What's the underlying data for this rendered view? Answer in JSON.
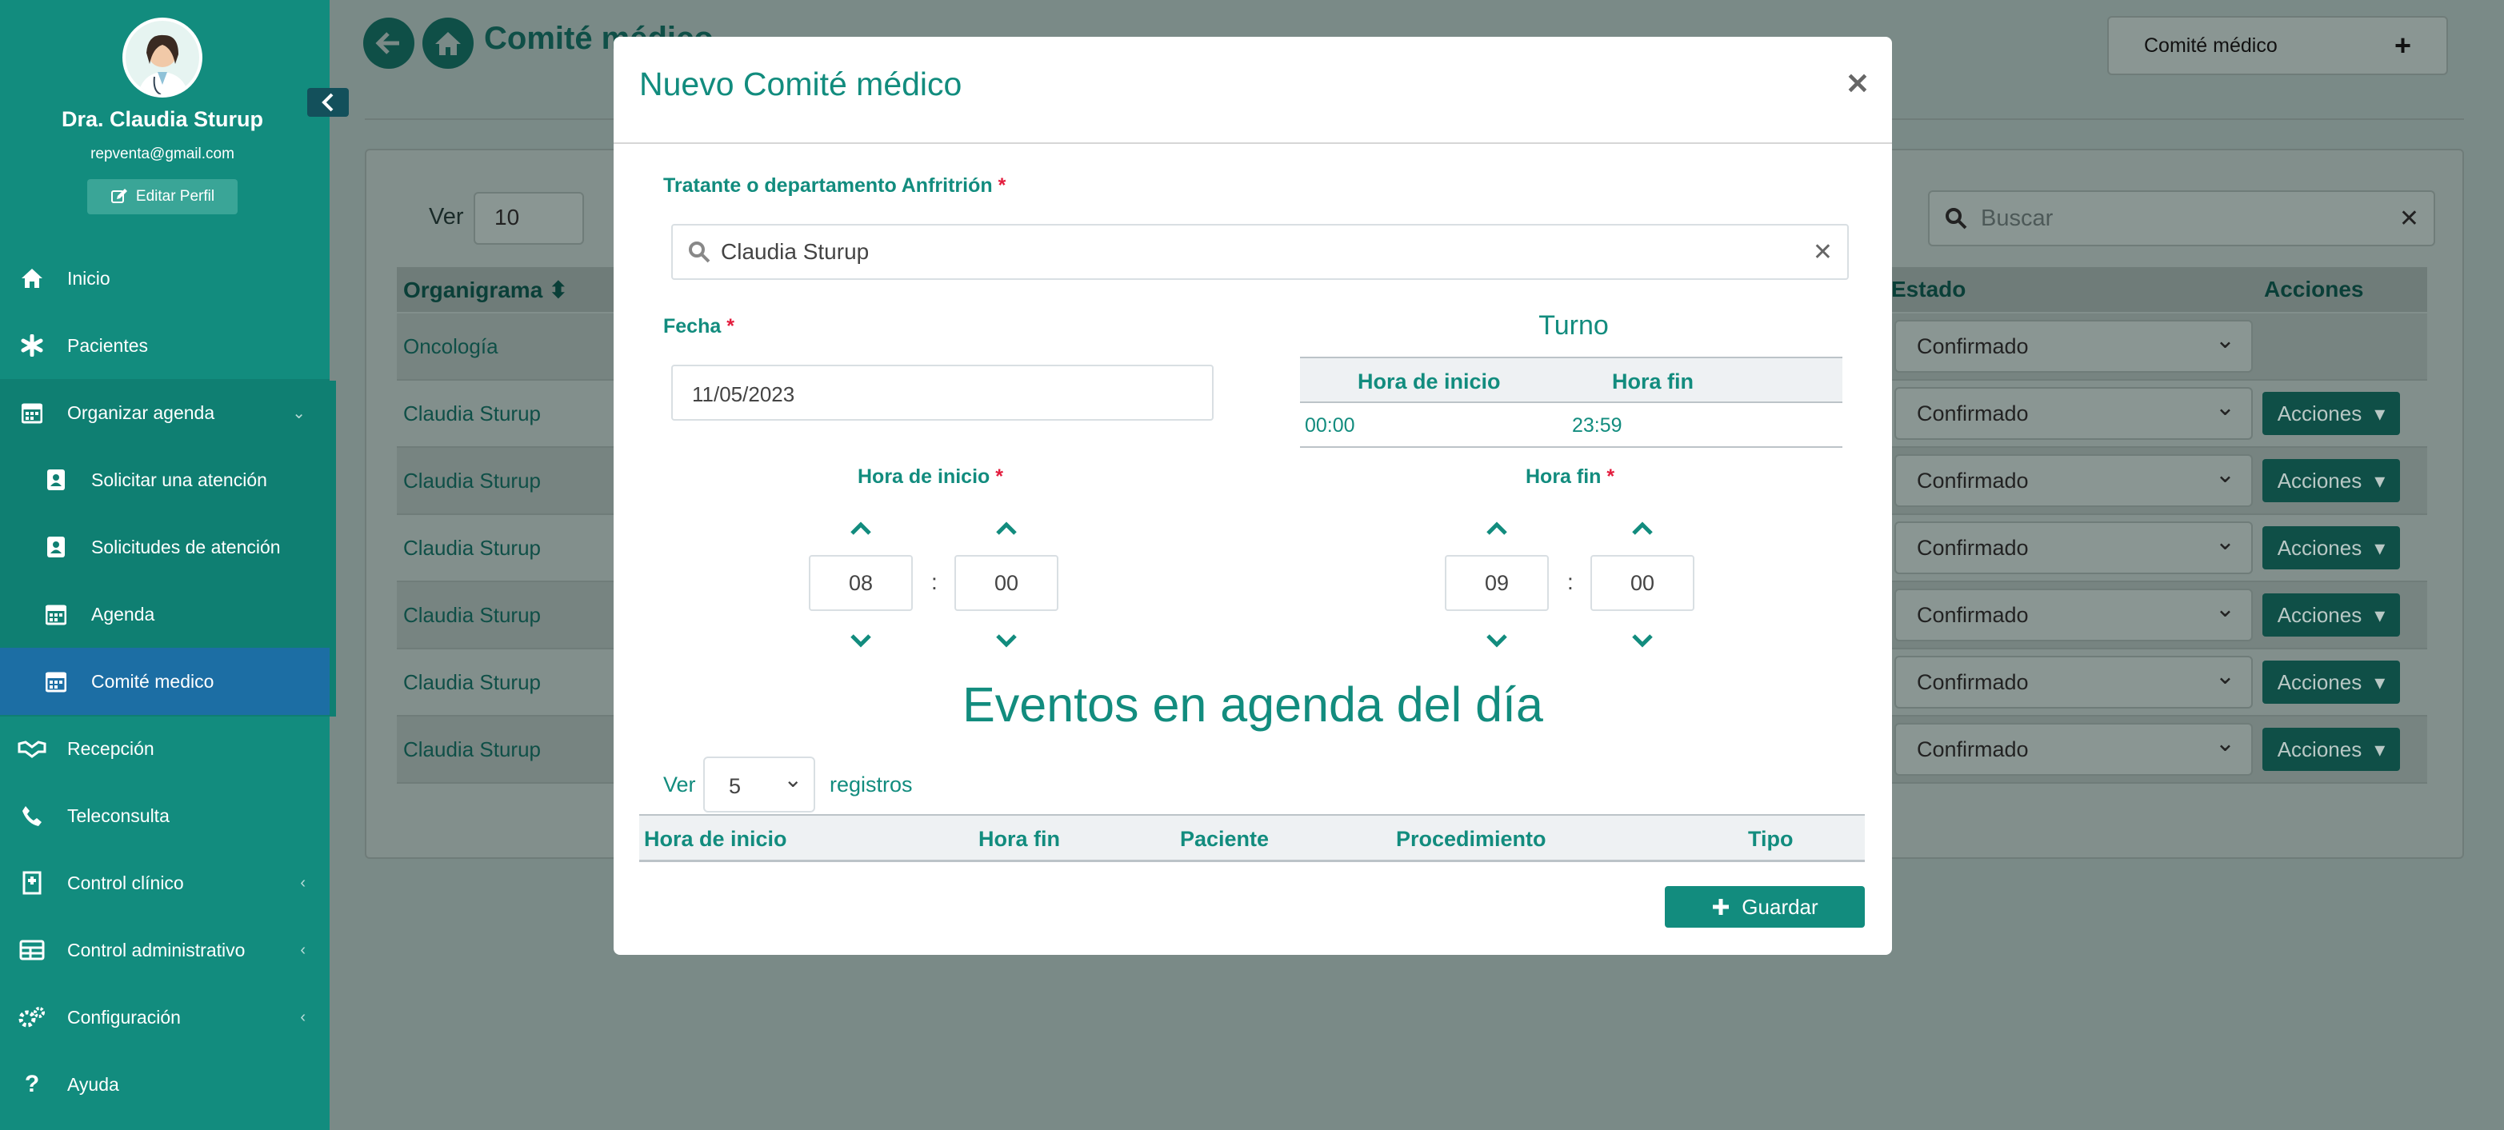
{
  "profile": {
    "name": "Dra. Claudia Sturup",
    "email": "repventa@gmail.com",
    "edit_label": "Editar Perfil"
  },
  "sidebar": {
    "items": [
      {
        "label": "Inicio",
        "icon": "home-icon"
      },
      {
        "label": "Pacientes",
        "icon": "asterisk-icon"
      },
      {
        "label": "Organizar agenda",
        "icon": "calendar-icon"
      },
      {
        "label": "Solicitar una atención",
        "icon": "id-card-icon"
      },
      {
        "label": "Solicitudes de atención",
        "icon": "id-card-icon"
      },
      {
        "label": "Agenda",
        "icon": "calendar-icon"
      },
      {
        "label": "Comité medico",
        "icon": "calendar-icon"
      },
      {
        "label": "Recepción",
        "icon": "handshake-icon"
      },
      {
        "label": "Teleconsulta",
        "icon": "phone-icon"
      },
      {
        "label": "Control clínico",
        "icon": "hospital-icon"
      },
      {
        "label": "Control administrativo",
        "icon": "table-icon"
      },
      {
        "label": "Configuración",
        "icon": "cogs-icon"
      },
      {
        "label": "Ayuda",
        "icon": "question-icon"
      }
    ]
  },
  "page": {
    "title": "Comité médico",
    "top_button_label": "Comité médico"
  },
  "list": {
    "ver_label": "Ver",
    "ver_value": "10",
    "search_placeholder": "Buscar",
    "headers": {
      "organigrama": "Organigrama",
      "estado": "Estado",
      "acciones": "Acciones"
    },
    "rows": [
      {
        "organigrama": "Oncología",
        "estado": "Confirmado",
        "acciones": ""
      },
      {
        "organigrama": "Claudia Sturup",
        "estado": "Confirmado",
        "acciones": "Acciones"
      },
      {
        "organigrama": "Claudia Sturup",
        "estado": "Confirmado",
        "acciones": "Acciones"
      },
      {
        "organigrama": "Claudia Sturup",
        "estado": "Confirmado",
        "acciones": "Acciones"
      },
      {
        "organigrama": "Claudia Sturup",
        "estado": "Confirmado",
        "acciones": "Acciones"
      },
      {
        "organigrama": "Claudia Sturup",
        "estado": "Confirmado",
        "acciones": "Acciones"
      },
      {
        "organigrama": "Claudia Sturup",
        "estado": "Confirmado",
        "acciones": "Acciones"
      }
    ]
  },
  "modal": {
    "title": "Nuevo Comité médico",
    "host_label": "Tratante o departamento Anfritrión",
    "host_value": "Claudia  Sturup",
    "fecha_label": "Fecha",
    "fecha_value": "11/05/2023",
    "turno": {
      "title": "Turno",
      "col_start": "Hora de inicio",
      "col_end": "Hora fin",
      "start": "00:00",
      "end": "23:59"
    },
    "hora_inicio_label": "Hora de inicio",
    "hora_inicio": {
      "h": "08",
      "m": "00"
    },
    "hora_fin_label": "Hora fin",
    "hora_fin": {
      "h": "09",
      "m": "00"
    },
    "colon": ":",
    "events_title": "Eventos en agenda del día",
    "ev_ver_label": "Ver",
    "ev_ver_value": "5",
    "ev_reg_label": "registros",
    "ev_headers": [
      "Hora de inicio",
      "Hora fin",
      "Paciente",
      "Procedimiento",
      "Tipo"
    ],
    "save_label": "Guardar",
    "required_mark": "*"
  },
  "colors": {
    "primary": "#128c7e",
    "accent": "#1c6ea4",
    "danger": "#e31c3d"
  }
}
